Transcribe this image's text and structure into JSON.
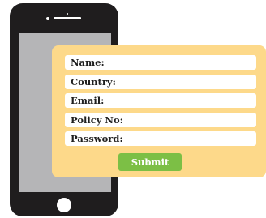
{
  "form": {
    "fields": [
      {
        "label": "Name:"
      },
      {
        "label": "Country:"
      },
      {
        "label": "Email:"
      },
      {
        "label": "Policy No:"
      },
      {
        "label": "Password:"
      }
    ],
    "submit_label": "Submit"
  },
  "colors": {
    "phone_body": "#1f1d1e",
    "phone_screen": "#b5b5b7",
    "card_background": "#fdd98a",
    "field_background": "#ffffff",
    "submit_button": "#7cbf45"
  },
  "icons": [
    "phone-illustration",
    "home-button-icon",
    "camera-icon",
    "speaker-icon"
  ]
}
